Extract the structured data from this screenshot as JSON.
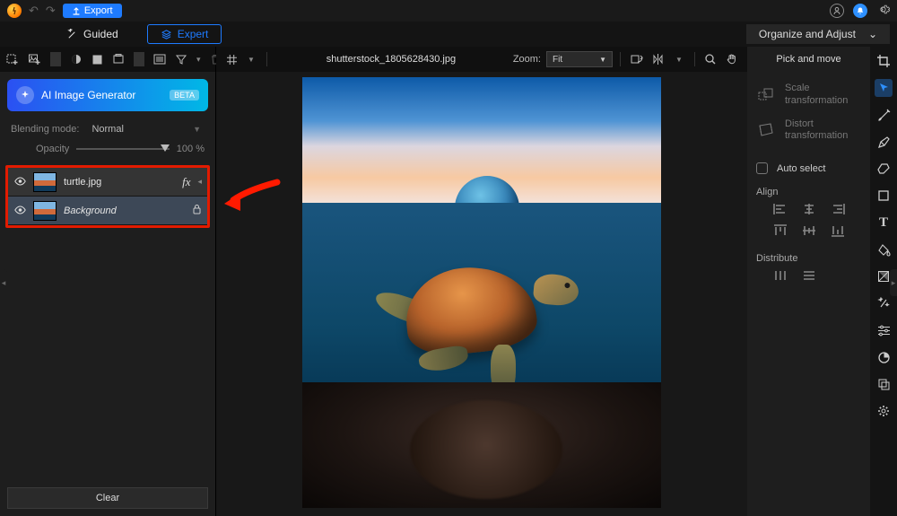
{
  "topbar": {
    "export_label": "Export"
  },
  "modes": {
    "guided": "Guided",
    "expert": "Expert",
    "organize": "Organize and Adjust"
  },
  "ai": {
    "title": "AI Image Generator",
    "badge": "BETA"
  },
  "blending": {
    "label": "Blending mode:",
    "value": "Normal",
    "opacity_label": "Opacity",
    "opacity_value": "100 %"
  },
  "layers": [
    {
      "name": "turtle.jpg",
      "italic": false,
      "fx": true,
      "locked": false
    },
    {
      "name": "Background",
      "italic": true,
      "fx": false,
      "locked": true
    }
  ],
  "left": {
    "clear": "Clear"
  },
  "canvas": {
    "filename": "shutterstock_1805628430.jpg",
    "zoom_label": "Zoom:",
    "zoom_value": "Fit"
  },
  "right": {
    "title": "Pick and move",
    "scale": "Scale\ntransformation",
    "distort": "Distort\ntransformation",
    "autoselect": "Auto select",
    "align": "Align",
    "distribute": "Distribute"
  }
}
